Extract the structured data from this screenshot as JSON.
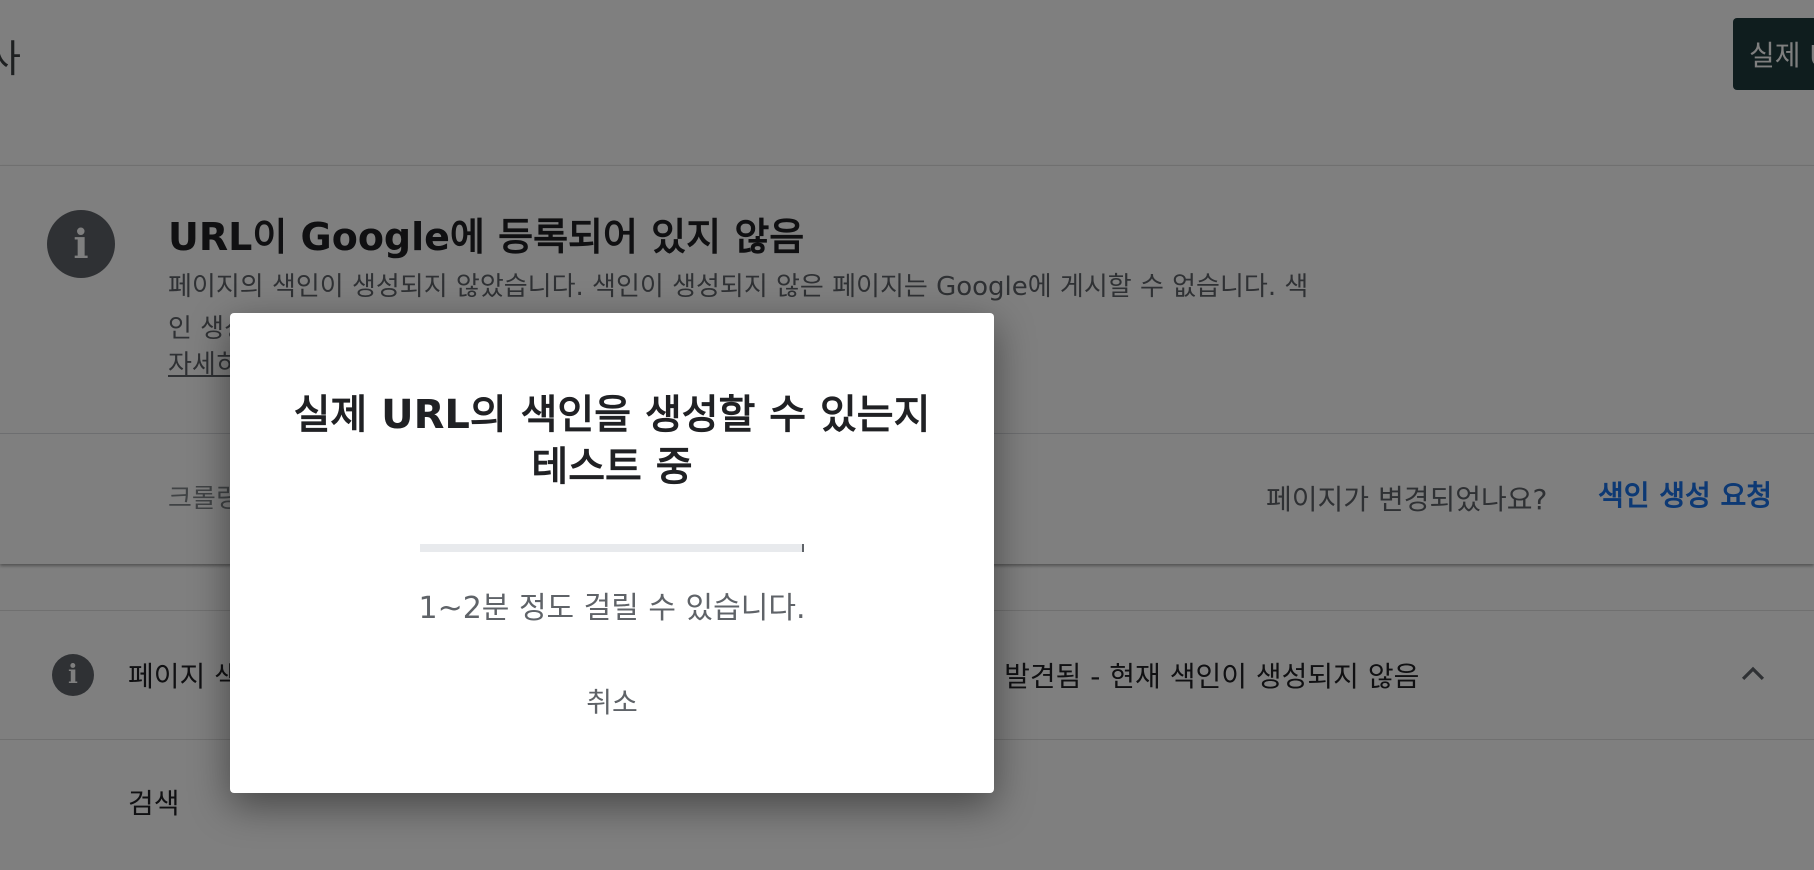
{
  "header": {
    "title_fragment": "사",
    "test_live_button_label": "실제 U"
  },
  "status_card": {
    "icon": "info-icon",
    "title": "URL이 Google에 등록되어 있지 않음",
    "description": "페이지의 색인이 생성되지 않았습니다. 색인이 생성되지 않은 페이지는 Google에 게시할 수 없습니다. 색인 생성 관련 문제를 확인하려면 아래의 세부정보를 참고하세요.",
    "learn_more_link": "자세히",
    "crawl_text": "크롤링",
    "page_changed_text": "페이지가 변경되었나요?",
    "request_indexing_label": "색인 생성 요청"
  },
  "coverage_row": {
    "icon": "info-icon",
    "label": "페이지 색",
    "status": "음: 발견됨 - 현재 색인이 생성되지 않음",
    "toggle_icon": "chevron-up-icon"
  },
  "search_section_label": "검색",
  "dialog": {
    "title_line1": "실제 URL의 색인을 생성할 수 있는지",
    "title_line2": "테스트 중",
    "progress_percent": 100,
    "hint": "1~2분 정도 걸릴 수 있습니다.",
    "cancel_label": "취소"
  },
  "colors": {
    "accent": "#1a73e8",
    "icon_gray": "#5f6368",
    "header_button_bg": "#1e3a3d"
  }
}
